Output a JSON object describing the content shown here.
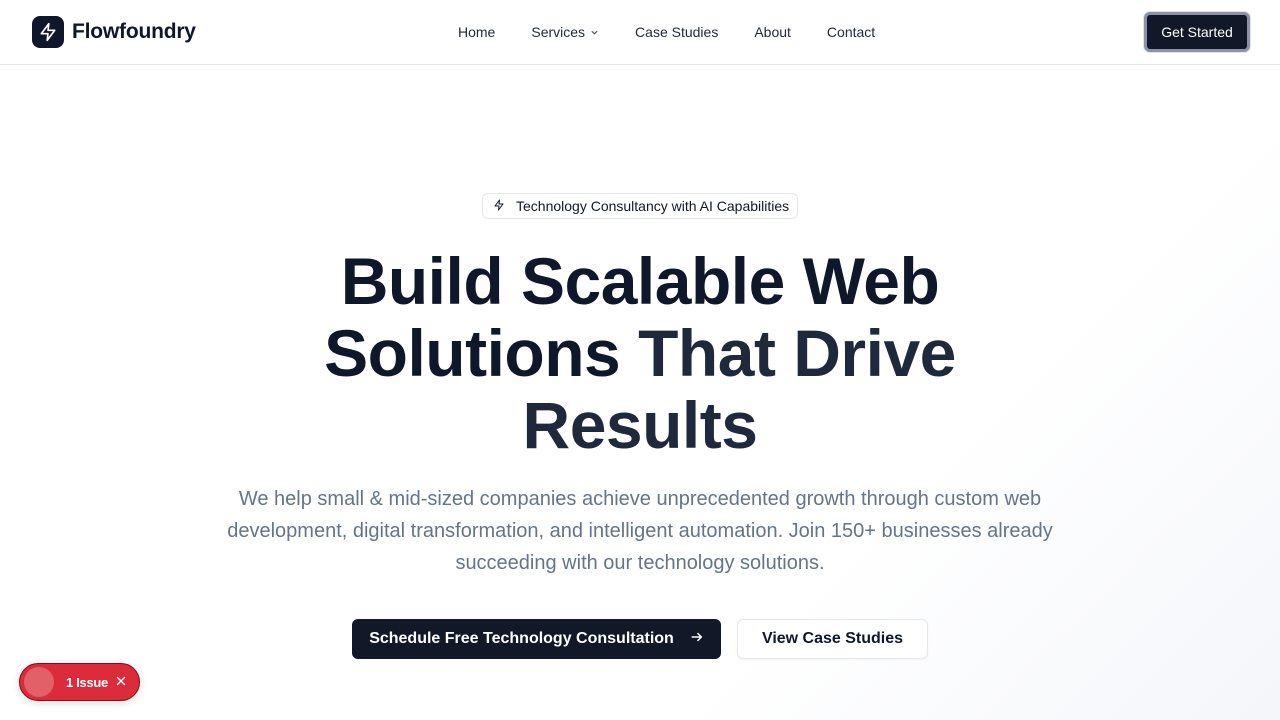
{
  "brand": {
    "name": "Flowfoundry",
    "logo_icon": "lightning-bolt-icon"
  },
  "nav": {
    "items": [
      {
        "label": "Home"
      },
      {
        "label": "Services",
        "has_dropdown": true
      },
      {
        "label": "Case Studies"
      },
      {
        "label": "About"
      },
      {
        "label": "Contact"
      }
    ],
    "cta_label": "Get Started"
  },
  "hero": {
    "badge": {
      "icon": "lightning-bolt-icon",
      "text": "Technology Consultancy with AI Capabilities"
    },
    "title_line1": "Build Scalable Web",
    "title_line2a": "Solutions ",
    "title_line2b": "That Drive",
    "title_line3": "Results",
    "subtitle": "We help small & mid-sized companies achieve unprecedented growth through custom web development, digital transformation, and intelligent automation. Join 150+ businesses already succeeding with our technology solutions.",
    "primary_button": "Schedule Free Technology Consultation",
    "secondary_button": "View Case Studies"
  },
  "issues_indicator": {
    "label": "1 Issue"
  },
  "colors": {
    "primary": "#111827",
    "text_muted": "#64748b",
    "issue_red": "#dc2b3a"
  }
}
